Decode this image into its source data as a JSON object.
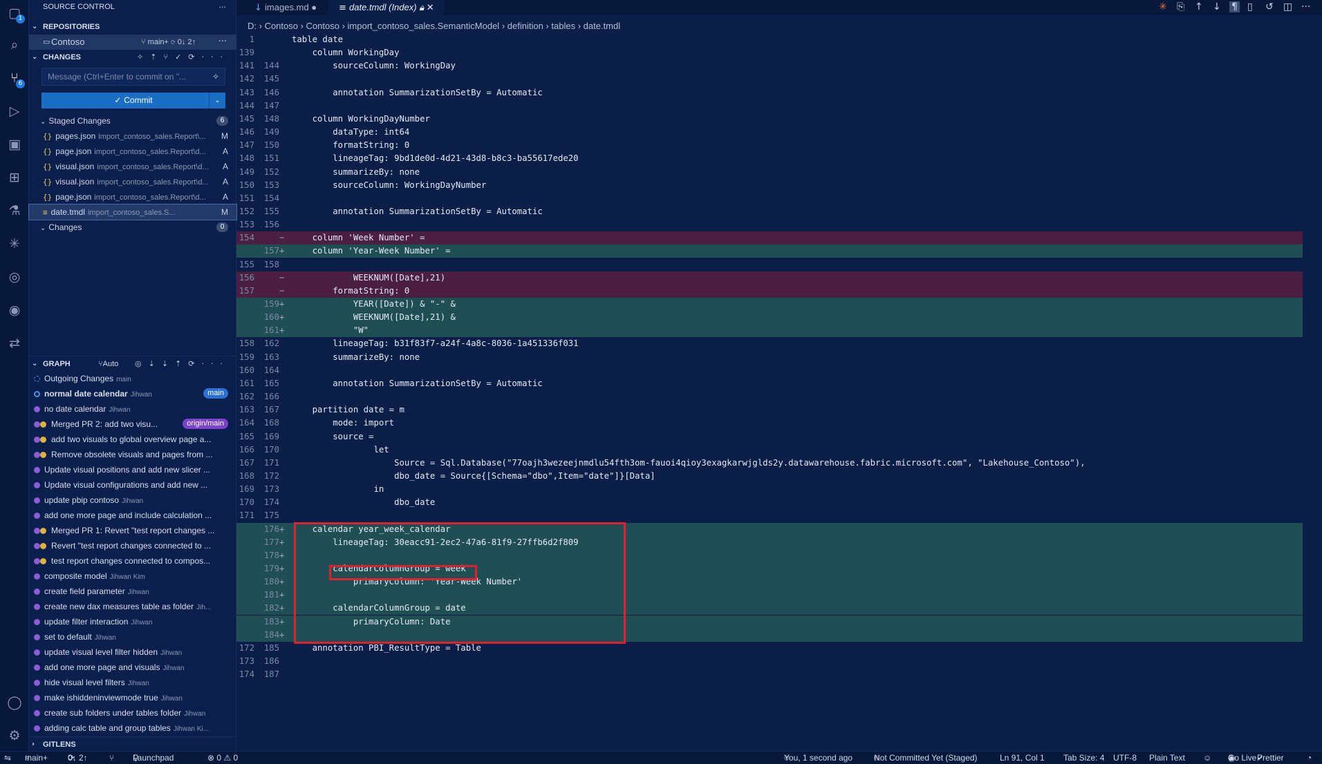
{
  "activity_bar": {
    "explorer_badge": "1",
    "scm_badge": "6",
    "icons": [
      "files-icon",
      "search-icon",
      "source-control-icon",
      "run-debug-icon",
      "remote-explorer-icon",
      "extensions-icon",
      "testing-icon",
      "fabric-icon",
      "gitlens-icon",
      "gitlens-inspect-icon",
      "pull-requests-icon"
    ],
    "bottom_icons": [
      "account-icon",
      "settings-gear-icon"
    ]
  },
  "sidebar": {
    "title": "SOURCE CONTROL",
    "repositories_header": "REPOSITORIES",
    "repo_name": "Contoso",
    "repo_branch": "main+",
    "repo_sync": "0↓ 2↑",
    "changes_header": "CHANGES",
    "message_placeholder": "Message (Ctrl+Enter to commit on \"...",
    "commit_label": "Commit",
    "staged_label": "Staged Changes",
    "staged_count": "6",
    "staged_files": [
      {
        "name": "pages.json",
        "path": "import_contoso_sales.Report\\...",
        "status": "M"
      },
      {
        "name": "page.json",
        "path": "import_contoso_sales.Report\\d...",
        "status": "A"
      },
      {
        "name": "visual.json",
        "path": "import_contoso_sales.Report\\d...",
        "status": "A"
      },
      {
        "name": "visual.json",
        "path": "import_contoso_sales.Report\\d...",
        "status": "A"
      },
      {
        "name": "page.json",
        "path": "import_contoso_sales.Report\\d...",
        "status": "A"
      },
      {
        "name": "date.tmdl",
        "path": "import_contoso_sales.S...",
        "status": "M"
      }
    ],
    "changes_label": "Changes",
    "changes_count": "0",
    "graph_header": "GRAPH",
    "graph_auto": "Auto",
    "graph": [
      {
        "msg": "Outgoing Changes",
        "author": "main",
        "bold": false,
        "indent": false
      },
      {
        "msg": "normal date calendar",
        "author": "Jihwan",
        "bold": true,
        "tag": "main",
        "indent": false
      },
      {
        "msg": "no date calendar",
        "author": "Jihwan",
        "indent": false
      },
      {
        "msg": "Merged PR 2: add two visu...",
        "author": "",
        "tag": "origin/main",
        "indent": true
      },
      {
        "msg": "add two visuals to global overview page a...",
        "author": "",
        "indent": true
      },
      {
        "msg": "Remove obsolete visuals and pages from ...",
        "author": "",
        "indent": true
      },
      {
        "msg": "Update visual positions and add new slicer ...",
        "author": "",
        "indent": false
      },
      {
        "msg": "Update visual configurations and add new ...",
        "author": "",
        "indent": false
      },
      {
        "msg": "update pbip contoso",
        "author": "Jihwan",
        "indent": false
      },
      {
        "msg": "add one more page and include calculation ...",
        "author": "",
        "indent": false
      },
      {
        "msg": "Merged PR 1: Revert \"test report changes ...",
        "author": "",
        "indent": true
      },
      {
        "msg": "Revert \"test report changes connected to ...",
        "author": "",
        "indent": true
      },
      {
        "msg": "test report changes connected to compos...",
        "author": "",
        "indent": true
      },
      {
        "msg": "composite model",
        "author": "Jihwan Kim",
        "indent": false
      },
      {
        "msg": "create field parameter",
        "author": "Jihwan",
        "indent": false
      },
      {
        "msg": "create new dax measures table as folder",
        "author": "Jih...",
        "indent": false
      },
      {
        "msg": "update filter interaction",
        "author": "Jihwan",
        "indent": false
      },
      {
        "msg": "set to default",
        "author": "Jihwan",
        "indent": false
      },
      {
        "msg": "update visual level filter hidden",
        "author": "Jihwan",
        "indent": false
      },
      {
        "msg": "add one more page and visuals",
        "author": "Jihwan",
        "indent": false
      },
      {
        "msg": "hide visual level filters",
        "author": "Jihwan",
        "indent": false
      },
      {
        "msg": "make ishiddeninviewmode true",
        "author": "Jihwan",
        "indent": false
      },
      {
        "msg": "create sub folders under tables folder",
        "author": "Jihwan",
        "indent": false
      },
      {
        "msg": "adding calc table and group tables",
        "author": "Jihwan Ki...",
        "indent": false
      }
    ],
    "gitlens_header": "GITLENS"
  },
  "tabs": [
    {
      "label": "images.md",
      "modified": "●",
      "active": false
    },
    {
      "label": "date.tmdl (Index)",
      "active": true
    }
  ],
  "breadcrumb": [
    "D:",
    "Contoso",
    "Contoso",
    "import_contoso_sales.SemanticModel",
    "definition",
    "tables",
    "date.tmdl"
  ],
  "code_lines": [
    {
      "a": "1",
      "b": "",
      "m": "",
      "t": "table date",
      "k": "n"
    },
    {
      "a": "139",
      "b": "",
      "m": "",
      "t": "    column WorkingDay",
      "k": "n"
    },
    {
      "a": "141",
      "b": "144",
      "m": "",
      "t": "        sourceColumn: WorkingDay",
      "k": "n"
    },
    {
      "a": "142",
      "b": "145",
      "m": "",
      "t": "",
      "k": "n"
    },
    {
      "a": "143",
      "b": "146",
      "m": "",
      "t": "        annotation SummarizationSetBy = Automatic",
      "k": "n"
    },
    {
      "a": "144",
      "b": "147",
      "m": "",
      "t": "",
      "k": "n"
    },
    {
      "a": "145",
      "b": "148",
      "m": "",
      "t": "    column WorkingDayNumber",
      "k": "n"
    },
    {
      "a": "146",
      "b": "149",
      "m": "",
      "t": "        dataType: int64",
      "k": "n"
    },
    {
      "a": "147",
      "b": "150",
      "m": "",
      "t": "        formatString: 0",
      "k": "n"
    },
    {
      "a": "148",
      "b": "151",
      "m": "",
      "t": "        lineageTag: 9bd1de0d-4d21-43d8-b8c3-ba55617ede20",
      "k": "n"
    },
    {
      "a": "149",
      "b": "152",
      "m": "",
      "t": "        summarizeBy: none",
      "k": "n"
    },
    {
      "a": "150",
      "b": "153",
      "m": "",
      "t": "        sourceColumn: WorkingDayNumber",
      "k": "n"
    },
    {
      "a": "151",
      "b": "154",
      "m": "",
      "t": "",
      "k": "n"
    },
    {
      "a": "152",
      "b": "155",
      "m": "",
      "t": "        annotation SummarizationSetBy = Automatic",
      "k": "n"
    },
    {
      "a": "153",
      "b": "156",
      "m": "",
      "t": "",
      "k": "n"
    },
    {
      "a": "154",
      "b": "",
      "m": "−",
      "t": "    column 'Week Number' =",
      "k": "del"
    },
    {
      "a": "",
      "b": "157",
      "m": "+",
      "t": "    column 'Year-Week Number' =",
      "k": "add"
    },
    {
      "a": "155",
      "b": "158",
      "m": "",
      "t": "",
      "k": "n"
    },
    {
      "a": "156",
      "b": "",
      "m": "−",
      "t": "            WEEKNUM([Date],21)",
      "k": "del"
    },
    {
      "a": "157",
      "b": "",
      "m": "−",
      "t": "        formatString: 0",
      "k": "del"
    },
    {
      "a": "",
      "b": "159",
      "m": "+",
      "t": "            YEAR([Date]) & \"-\" &",
      "k": "add"
    },
    {
      "a": "",
      "b": "160",
      "m": "+",
      "t": "            WEEKNUM([Date],21) &",
      "k": "add"
    },
    {
      "a": "",
      "b": "161",
      "m": "+",
      "t": "            \"W\"",
      "k": "add"
    },
    {
      "a": "158",
      "b": "162",
      "m": "",
      "t": "        lineageTag: b31f83f7-a24f-4a8c-8036-1a451336f031",
      "k": "n"
    },
    {
      "a": "159",
      "b": "163",
      "m": "",
      "t": "        summarizeBy: none",
      "k": "n"
    },
    {
      "a": "160",
      "b": "164",
      "m": "",
      "t": "",
      "k": "n"
    },
    {
      "a": "161",
      "b": "165",
      "m": "",
      "t": "        annotation SummarizationSetBy = Automatic",
      "k": "n"
    },
    {
      "a": "162",
      "b": "166",
      "m": "",
      "t": "",
      "k": "n"
    },
    {
      "a": "163",
      "b": "167",
      "m": "",
      "t": "    partition date = m",
      "k": "n"
    },
    {
      "a": "164",
      "b": "168",
      "m": "",
      "t": "        mode: import",
      "k": "n"
    },
    {
      "a": "165",
      "b": "169",
      "m": "",
      "t": "        source =",
      "k": "n"
    },
    {
      "a": "166",
      "b": "170",
      "m": "",
      "t": "                let",
      "k": "n"
    },
    {
      "a": "167",
      "b": "171",
      "m": "",
      "t": "                    Source = Sql.Database(\"77oajh3wezeejnmdlu54fth3om-fauoi4qioy3exagkarwjglds2y.datawarehouse.fabric.microsoft.com\", \"Lakehouse_Contoso\"),",
      "k": "n"
    },
    {
      "a": "168",
      "b": "172",
      "m": "",
      "t": "                    dbo_date = Source{[Schema=\"dbo\",Item=\"date\"]}[Data]",
      "k": "n"
    },
    {
      "a": "169",
      "b": "173",
      "m": "",
      "t": "                in",
      "k": "n"
    },
    {
      "a": "170",
      "b": "174",
      "m": "",
      "t": "                    dbo_date",
      "k": "n"
    },
    {
      "a": "171",
      "b": "175",
      "m": "",
      "t": "",
      "k": "n"
    },
    {
      "a": "",
      "b": "176",
      "m": "+",
      "t": "    calendar year_week_calendar",
      "k": "add"
    },
    {
      "a": "",
      "b": "177",
      "m": "+",
      "t": "        lineageTag: 30eacc91-2ec2-47a6-81f9-27ffb6d2f809",
      "k": "add"
    },
    {
      "a": "",
      "b": "178",
      "m": "+",
      "t": "",
      "k": "add"
    },
    {
      "a": "",
      "b": "179",
      "m": "+",
      "t": "        calendarColumnGroup = week",
      "k": "add"
    },
    {
      "a": "",
      "b": "180",
      "m": "+",
      "t": "            primaryColumn: 'Year-Week Number'",
      "k": "add"
    },
    {
      "a": "",
      "b": "181",
      "m": "+",
      "t": "",
      "k": "add"
    },
    {
      "a": "",
      "b": "182",
      "m": "+",
      "t": "        calendarColumnGroup = date",
      "k": "add"
    },
    {
      "a": "",
      "b": "183",
      "m": "+",
      "t": "            primaryColumn: Date",
      "k": "add"
    },
    {
      "a": "",
      "b": "184",
      "m": "+",
      "t": "",
      "k": "add"
    },
    {
      "a": "172",
      "b": "185",
      "m": "",
      "t": "    annotation PBI_ResultType = Table",
      "k": "n"
    },
    {
      "a": "173",
      "b": "186",
      "m": "",
      "t": "",
      "k": "n"
    },
    {
      "a": "174",
      "b": "187",
      "m": "",
      "t": "",
      "k": "n"
    }
  ],
  "status": {
    "branch": "main+",
    "sync": "0↓ 2↑",
    "launchpad": "Launchpad",
    "problems": "⊗ 0 ⚠ 0",
    "blame": "You, 1 second ago",
    "commit_state": "Not Committed Yet (Staged)",
    "position": "Ln 91, Col 1",
    "tab_size": "Tab Size: 4",
    "encoding": "UTF-8",
    "language": "Plain Text",
    "go_live": "Go Live",
    "prettier": "Prettier"
  }
}
